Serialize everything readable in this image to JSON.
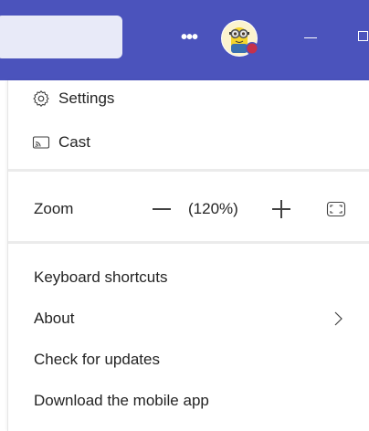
{
  "titlebar": {
    "background": "#4b53bc",
    "more_label": "•••",
    "avatar_icon": "minion-avatar-icon",
    "presence_color": "#c4314b"
  },
  "menu": {
    "settings_label": "Settings",
    "cast_label": "Cast",
    "zoom": {
      "label": "Zoom",
      "value": "(120%)"
    },
    "keyboard_shortcuts_label": "Keyboard shortcuts",
    "about_label": "About",
    "check_updates_label": "Check for updates",
    "download_mobile_label": "Download the mobile app"
  }
}
